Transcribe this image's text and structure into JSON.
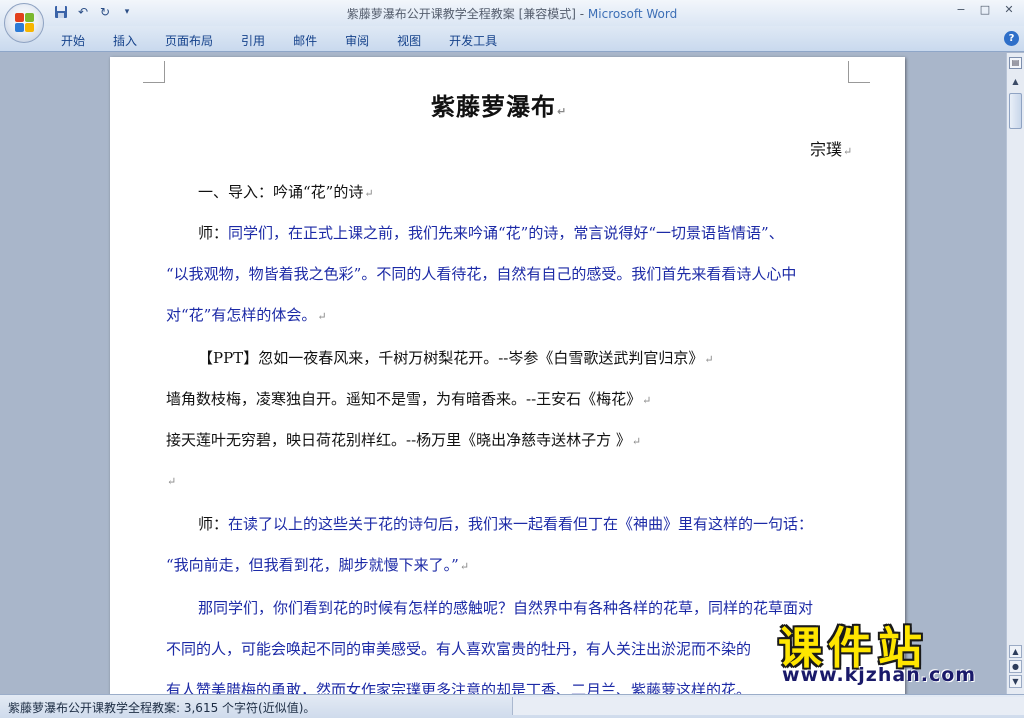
{
  "window": {
    "doc_title": "紫藤萝瀑布公开课教学全程教案 [兼容模式] - ",
    "app_name": "Microsoft Word",
    "ctrl_min": "−",
    "ctrl_max": "□",
    "ctrl_close": "✕"
  },
  "qat": {
    "save_icon": "save-icon",
    "undo": "↶",
    "redo": "↻",
    "more": "▾"
  },
  "ribbon": {
    "tabs": [
      "开始",
      "插入",
      "页面布局",
      "引用",
      "邮件",
      "审阅",
      "视图",
      "开发工具"
    ],
    "help": "?"
  },
  "document": {
    "title": "紫藤萝瀑布",
    "author": "宗璞",
    "para_mark": "↵",
    "lines": [
      "一、导入：吟诵“花”的诗",
      "师：",
      "同学们，在正式上课之前，我们先来吟诵“花”的诗，常言说得好“一切景语皆情语”、",
      "“以我观物，物皆着我之色彩”。不同的人看待花，自然有自己的感受。我们首先来看看诗人心中",
      "对“花”有怎样的体会。",
      "【PPT】忽如一夜春风来，千树万树梨花开。--岑参《白雪歌送武判官归京》",
      "墙角数枝梅，凌寒独自开。遥知不是雪，为有暗香来。--王安石《梅花》",
      "接天莲叶无穷碧，映日荷花别样红。--杨万里《晓出净慈寺送林子方 》",
      "师：",
      "在读了以上的这些关于花的诗句后，我们来一起看看但丁在《神曲》里有这样的一句话：",
      "“我向前走，但我看到花，脚步就慢下来了。”",
      "那同学们，你们看到花的时候有怎样的感触呢？自然界中有各种各样的花草，同样的花草面对",
      "不同的人，可能会唤起不同的审美感受。有人喜欢富贵的牡丹，有人关注出淤泥而不染的",
      "有人赞美腊梅的勇敢，然而女作家宗璞更多注意的却是丁香、二月兰、紫藤萝这样的花。"
    ]
  },
  "status": {
    "text": "紫藤萝瀑布公开课教学全程教案: 3,615 个字符(近似值)。"
  },
  "watermark": {
    "big": "课件站",
    "small": "www.kjzhan.com"
  },
  "colors": {
    "accent_blue": "#1c2aa6",
    "office_red": "#e2401c"
  }
}
